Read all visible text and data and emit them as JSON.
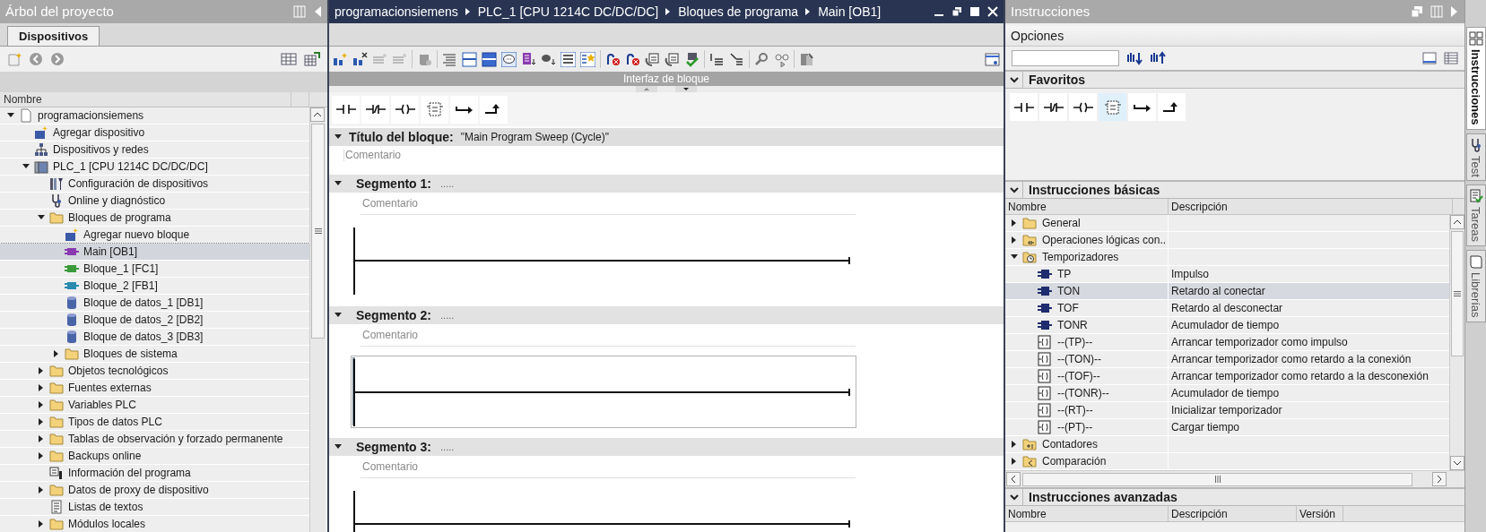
{
  "project_tree": {
    "title": "Árbol del proyecto",
    "tabs": [
      {
        "label": "Dispositivos",
        "selected": true
      }
    ],
    "column": "Nombre",
    "items": [
      {
        "label": "programacionsiemens",
        "kind": "project",
        "expanded": true,
        "selected": false,
        "children": [
          {
            "label": "Agregar dispositivo",
            "kind": "add-device",
            "selected": false
          },
          {
            "label": "Dispositivos y redes",
            "kind": "network",
            "selected": false
          },
          {
            "label": "PLC_1 [CPU 1214C DC/DC/DC]",
            "kind": "plc",
            "expanded": true,
            "selected": false,
            "children": [
              {
                "label": "Configuración de dispositivos",
                "kind": "config",
                "selected": false
              },
              {
                "label": "Online y diagnóstico",
                "kind": "diagnostic",
                "selected": false
              },
              {
                "label": "Bloques de programa",
                "kind": "folder",
                "expanded": true,
                "selected": false,
                "children": [
                  {
                    "label": "Agregar nuevo bloque",
                    "kind": "add-block",
                    "selected": false
                  },
                  {
                    "label": "Main [OB1]",
                    "kind": "ob",
                    "selected": true
                  },
                  {
                    "label": "Bloque_1 [FC1]",
                    "kind": "fc",
                    "selected": false
                  },
                  {
                    "label": "Bloque_2 [FB1]",
                    "kind": "fb",
                    "selected": false
                  },
                  {
                    "label": "Bloque de datos_1 [DB1]",
                    "kind": "db",
                    "selected": false
                  },
                  {
                    "label": "Bloque de datos_2 [DB2]",
                    "kind": "db",
                    "selected": false
                  },
                  {
                    "label": "Bloque de datos_3 [DB3]",
                    "kind": "db",
                    "selected": false
                  },
                  {
                    "label": "Bloques de sistema",
                    "kind": "folder",
                    "expanded": false,
                    "selected": false
                  }
                ]
              },
              {
                "label": "Objetos tecnológicos",
                "kind": "folder",
                "expanded": false,
                "selected": false
              },
              {
                "label": "Fuentes externas",
                "kind": "folder",
                "expanded": false,
                "selected": false
              },
              {
                "label": "Variables PLC",
                "kind": "folder",
                "expanded": false,
                "selected": false
              },
              {
                "label": "Tipos de datos PLC",
                "kind": "folder",
                "expanded": false,
                "selected": false
              },
              {
                "label": "Tablas de observación y forzado permanente",
                "kind": "folder",
                "expanded": false,
                "selected": false
              },
              {
                "label": "Backups online",
                "kind": "folder",
                "expanded": false,
                "selected": false
              },
              {
                "label": "Información del programa",
                "kind": "info",
                "selected": false
              },
              {
                "label": "Datos de proxy de dispositivo",
                "kind": "folder",
                "expanded": false,
                "selected": false
              },
              {
                "label": "Listas de textos",
                "kind": "text-list",
                "selected": false
              },
              {
                "label": "Módulos locales",
                "kind": "folder",
                "expanded": false,
                "selected": false
              }
            ]
          }
        ]
      }
    ]
  },
  "editor": {
    "breadcrumb": [
      "programacionsiemens",
      "PLC_1 [CPU 1214C DC/DC/DC]",
      "Bloques de programa",
      "Main [OB1]"
    ],
    "interface_label": "Interfaz de bloque",
    "block_title_label": "Título del bloque:",
    "block_title": "\"Main Program Sweep (Cycle)\"",
    "block_comment": "Comentario",
    "block_expanded": true,
    "segments": [
      {
        "title": "Segmento 1:",
        "dots": ".....",
        "comment": "Comentario",
        "expanded": true,
        "selected": false
      },
      {
        "title": "Segmento 2:",
        "dots": ".....",
        "comment": "Comentario",
        "expanded": true,
        "selected": true
      },
      {
        "title": "Segmento 3:",
        "dots": ".....",
        "comment": "Comentario",
        "expanded": true,
        "selected": false
      }
    ]
  },
  "instructions": {
    "title": "Instrucciones",
    "options_label": "Opciones",
    "favorites": {
      "title": "Favoritos",
      "expanded": true
    },
    "basic": {
      "title": "Instrucciones básicas",
      "expanded": true,
      "columns": [
        "Nombre",
        "Descripción"
      ],
      "rows": [
        {
          "name": "General",
          "description": "",
          "kind": "folder",
          "expanded": false,
          "selected": false
        },
        {
          "name": "Operaciones lógicas con..",
          "description": "",
          "kind": "logic-folder",
          "expanded": false,
          "selected": false
        },
        {
          "name": "Temporizadores",
          "description": "",
          "kind": "timer-folder",
          "expanded": true,
          "selected": false,
          "children": [
            {
              "name": "TP",
              "description": "Impulso",
              "kind": "box",
              "selected": false
            },
            {
              "name": "TON",
              "description": "Retardo al conectar",
              "kind": "box",
              "selected": true
            },
            {
              "name": "TOF",
              "description": "Retardo al desconectar",
              "kind": "box",
              "selected": false
            },
            {
              "name": "TONR",
              "description": "Acumulador de tiempo",
              "kind": "box",
              "selected": false
            },
            {
              "name": "--(TP)--",
              "description": "Arrancar temporizador como impulso",
              "kind": "coil",
              "selected": false
            },
            {
              "name": "--(TON)--",
              "description": "Arrancar temporizador como retardo a la conexión",
              "kind": "coil",
              "selected": false
            },
            {
              "name": "--(TOF)--",
              "description": "Arrancar temporizador como retardo a la desconexión",
              "kind": "coil",
              "selected": false
            },
            {
              "name": "--(TONR)--",
              "description": "Acumulador de tiempo",
              "kind": "coil",
              "selected": false
            },
            {
              "name": "--(RT)--",
              "description": "Inicializar temporizador",
              "kind": "coil",
              "selected": false
            },
            {
              "name": "--(PT)--",
              "description": "Cargar tiempo",
              "kind": "coil",
              "selected": false
            }
          ]
        },
        {
          "name": "Contadores",
          "description": "",
          "kind": "counter-folder",
          "expanded": false,
          "selected": false
        },
        {
          "name": "Comparación",
          "description": "",
          "kind": "compare-folder",
          "expanded": false,
          "selected": false
        }
      ]
    },
    "advanced": {
      "title": "Instrucciones avanzadas",
      "expanded": true,
      "columns": [
        "Nombre",
        "Descripción",
        "Versión"
      ]
    }
  },
  "side_tabs": [
    {
      "label": "Instrucciones",
      "kind": "grid",
      "selected": true
    },
    {
      "label": "Test",
      "kind": "diagnostic",
      "selected": false
    },
    {
      "label": "Tareas",
      "kind": "tasks",
      "selected": false
    },
    {
      "label": "Librerías",
      "kind": "book",
      "selected": false
    }
  ]
}
